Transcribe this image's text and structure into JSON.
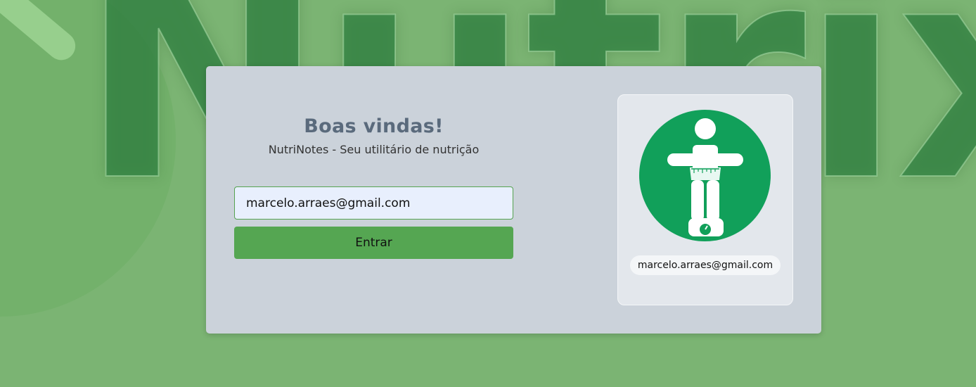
{
  "background": {
    "logo_text": "Nutrix"
  },
  "login": {
    "title": "Boas vindas!",
    "subtitle": "NutriNotes - Seu utilitário de nutrição",
    "email_value": "marcelo.arraes@gmail.com",
    "submit_label": "Entrar"
  },
  "profile": {
    "avatar_icon": "person-on-scale-icon",
    "email": "marcelo.arraes@gmail.com"
  },
  "colors": {
    "page_background": "#7bb473",
    "card_background": "#cbd2da",
    "accent_green": "#55a652",
    "avatar_green": "#11a05a"
  }
}
